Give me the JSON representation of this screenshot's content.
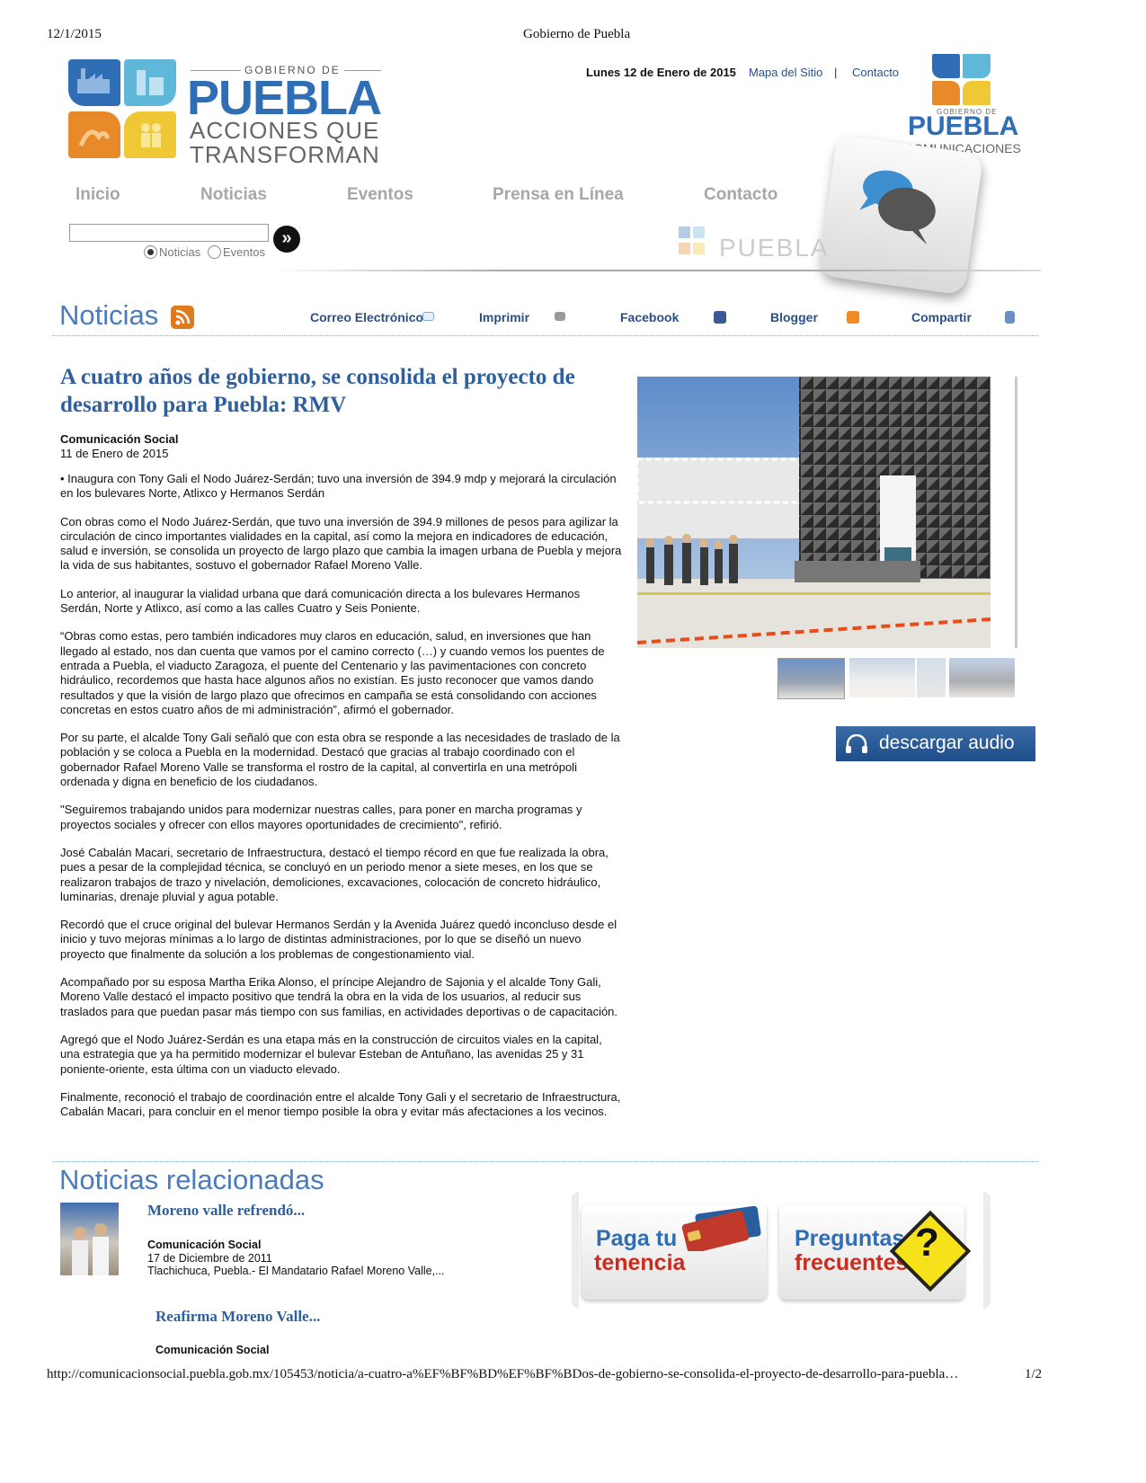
{
  "print_header": {
    "date": "12/1/2015",
    "page_title": "Gobierno de Puebla",
    "footer_url": "http://comunicacionsocial.puebla.gob.mx/105453/noticia/a-cuatro-a%EF%BF%BD%EF%BF%BDos-de-gobierno-se-consolida-el-proyecto-de-desarrollo-para-puebla…",
    "page_count": "1/2"
  },
  "logo": {
    "gobierno_de": "GOBIERNO DE",
    "puebla": "PUEBLA",
    "line1": "ACCIONES QUE",
    "line2": "TRANSFORMAN"
  },
  "top_bar": {
    "date": "Lunes 12 de Enero de 2015",
    "sitemap": "Mapa del Sitio",
    "separator": "|",
    "contact": "Contacto"
  },
  "side_logo": {
    "gobierno_de": "GOBIERNO DE",
    "puebla": "PUEBLA",
    "sub": "COMUNICACIONES"
  },
  "nav": {
    "items": [
      "Inicio",
      "Noticias",
      "Eventos",
      "Prensa en Línea",
      "Contacto"
    ]
  },
  "search": {
    "value": "",
    "radio_news": "Noticias",
    "radio_events": "Eventos",
    "go": "»"
  },
  "watermark": "PUEBLA",
  "section": {
    "title": "Noticias",
    "share": {
      "email": "Correo Electrónico",
      "print": "Imprimir",
      "facebook": "Facebook",
      "blogger": "Blogger",
      "share": "Compartir"
    }
  },
  "article": {
    "title": "A cuatro años de gobierno, se consolida el proyecto de desarrollo para Puebla: RMV",
    "author": "Comunicación Social",
    "date": "11 de Enero de 2015",
    "paragraphs": [
      "• Inaugura con Tony Gali el Nodo Juárez-Serdán; tuvo una inversión de 394.9 mdp y mejorará la circulación en los bulevares Norte, Atlixco y Hermanos Serdán",
      "Con obras como el Nodo Juárez-Serdán, que tuvo una inversión de 394.9 millones de pesos para agilizar la circulación de cinco importantes vialidades en la capital, así como la mejora en indicadores de educación, salud e inversión, se consolida un proyecto de largo plazo que cambia la imagen urbana de Puebla y mejora la vida de sus habitantes, sostuvo el gobernador Rafael Moreno Valle.",
      "Lo anterior, al inaugurar la vialidad urbana que dará comunicación directa a los bulevares Hermanos Serdán, Norte y Atlixco, así como a las calles Cuatro y Seis Poniente.",
      "“Obras como estas, pero también indicadores muy claros en educación, salud, en inversiones que han llegado al estado, nos dan cuenta que vamos por el camino correcto (…) y cuando  vemos los puentes de entrada a Puebla, el viaducto Zaragoza, el puente del Centenario y las pavimentaciones con concreto hidráulico, recordemos que hasta hace algunos años no existían. Es justo reconocer que vamos dando resultados y que la visión de largo plazo que ofrecimos en campaña se está consolidando con acciones concretas en estos cuatro años de mi administración”, afirmó el gobernador.",
      "Por su parte, el alcalde Tony Gali señaló que con esta obra se responde a las necesidades de traslado de la población y se coloca a Puebla en la modernidad. Destacó que gracias al trabajo coordinado con el gobernador Rafael Moreno Valle se transforma el rostro de la capital, al convertirla en una metrópoli  ordenada y digna en beneficio de los ciudadanos.",
      "\"Seguiremos trabajando unidos para modernizar nuestras calles, para poner en marcha programas y proyectos sociales y ofrecer con ellos mayores oportunidades de crecimiento\", refirió.",
      "José Cabalán Macari, secretario de Infraestructura, destacó el tiempo récord en que fue realizada la obra, pues a pesar de la complejidad técnica, se concluyó en un periodo menor a siete meses, en los que se realizaron trabajos de  trazo y nivelación, demoliciones, excavaciones, colocación de concreto hidráulico, luminarias, drenaje pluvial y agua potable.",
      "Recordó que el cruce original del bulevar Hermanos Serdán y la Avenida Juárez quedó inconcluso desde el inicio y tuvo mejoras mínimas a lo largo de distintas administraciones, por lo que se diseñó un nuevo proyecto que finalmente da solución a los problemas de congestionamiento vial.",
      "Acompañado por su esposa Martha Erika Alonso, el príncipe Alejandro de Sajonia y el alcalde Tony Gali, Moreno Valle destacó el impacto positivo que tendrá la obra en la vida de los usuarios, al reducir sus traslados para que puedan pasar más tiempo con sus familias, en actividades deportivas o de capacitación.",
      "Agregó que el Nodo Juárez-Serdán es una etapa más en la construcción de circuitos viales en la capital, una estrategia que ya ha permitido modernizar el bulevar Esteban de Antuñano, las avenidas 25 y 31 poniente-oriente, esta última con un viaducto elevado.",
      "Finalmente, reconoció el trabajo de coordinación entre el alcalde Tony Gali y el secretario de Infraestructura, Cabalán Macari, para concluir en el menor tiempo posible la obra y evitar más afectaciones a los vecinos."
    ]
  },
  "audio_button": "descargar audio",
  "related": {
    "heading": "Noticias relacionadas",
    "items": [
      {
        "title": "Moreno valle refrendó...",
        "author": "Comunicación Social",
        "date": "17 de Diciembre de 2011",
        "summary": "Tlachichuca, Puebla.- El Mandatario Rafael Moreno Valle,..."
      },
      {
        "title": "Reafirma Moreno Valle...",
        "author": "Comunicación Social"
      }
    ]
  },
  "promos": {
    "tenencia_1": "Paga tu",
    "tenencia_2": "tenencia",
    "faq_1": "Preguntas",
    "faq_2": "frecuentes",
    "faq_mark": "?"
  },
  "colors": {
    "brand_blue": "#2f6eb4",
    "link_blue": "#2a4f88",
    "title_blue": "#2f5f9c",
    "audio_bg": "#1e4e8a"
  }
}
